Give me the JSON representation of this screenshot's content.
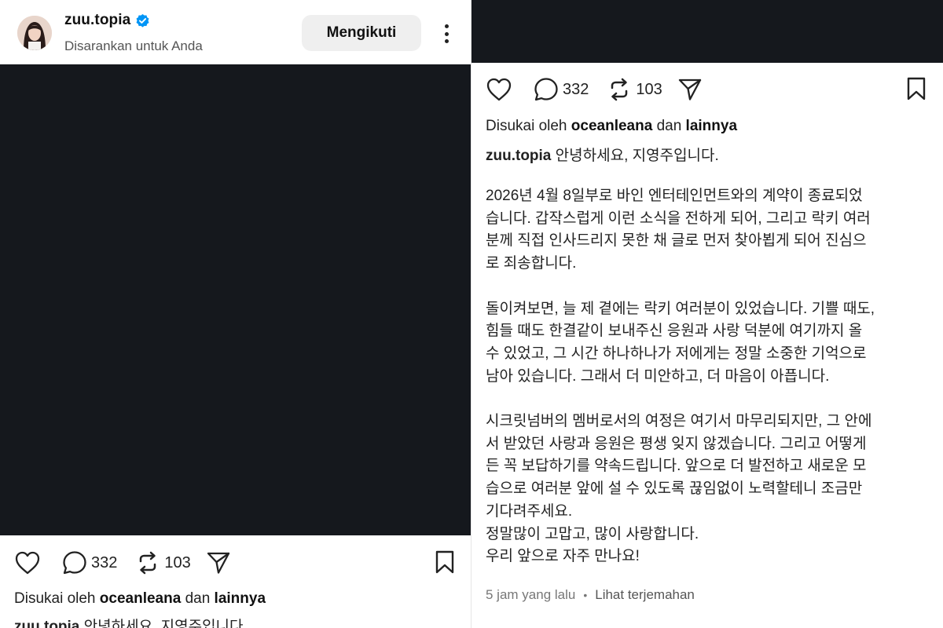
{
  "post": {
    "username": "zuu.topia",
    "subtitle": "Disarankan untuk Anda",
    "follow_label": "Mengikuti",
    "more_icon": "more-vertical-icon",
    "verified_icon": "verified-badge-icon",
    "accent": "#0095f6",
    "media_color": "#15181d"
  },
  "actions": {
    "like_icon": "heart-icon",
    "comment_icon": "comment-icon",
    "comment_count": "332",
    "repost_icon": "repost-icon",
    "repost_count": "103",
    "share_icon": "send-icon",
    "save_icon": "bookmark-icon"
  },
  "likes": {
    "prefix": "Disukai oleh",
    "user": "oceanleana",
    "middle": "dan",
    "others": "lainnya"
  },
  "caption": {
    "author": "zuu.topia",
    "first_line": "안녕하세요, 지영주입니다.",
    "paragraphs": [
      "2026년 4월 8일부로 바인 엔터테인먼트와의 계약이 종료되었\n습니다. 갑작스럽게 이런 소식을 전하게 되어, 그리고 락키 여러\n분께 직접 인사드리지 못한 채 글로 먼저 찾아뵙게 되어 진심으\n로 죄송합니다.",
      "돌이켜보면, 늘 제 곁에는 락키 여러분이 있었습니다. 기쁠 때도,\n힘들 때도 한결같이 보내주신 응원과 사랑 덕분에 여기까지 올\n수 있었고, 그 시간 하나하나가 저에게는 정말 소중한 기억으로\n남아 있습니다. 그래서 더 미안하고, 더 마음이 아픕니다.",
      "시크릿넘버의 멤버로서의 여정은 여기서 마무리되지만, 그 안에\n서 받았던 사랑과 응원은 평생 잊지 않겠습니다. 그리고 어떻게\n든 꼭 보답하기를 약속드립니다. 앞으로 더 발전하고 새로운 모\n습으로 여러분 앞에 설 수 있도록 끊임없이 노력할테니 조금만\n기다려주세요.\n정말많이 고맙고, 많이 사랑합니다.\n우리 앞으로 자주 만나요!"
    ]
  },
  "meta": {
    "time": "5 jam yang lalu",
    "separator": "•",
    "translate": "Lihat terjemahan"
  }
}
